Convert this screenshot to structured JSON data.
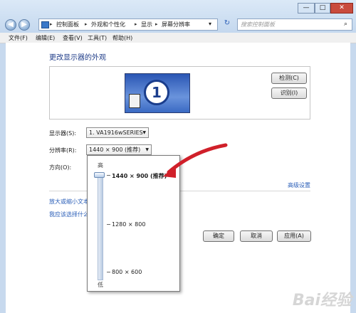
{
  "address_bar": {
    "breadcrumbs": [
      "控制面板",
      "外观和个性化",
      "显示",
      "屏幕分辨率"
    ]
  },
  "search": {
    "placeholder": "搜索控制面板"
  },
  "menu": {
    "items": [
      "文件(F)",
      "编辑(E)",
      "查看(V)",
      "工具(T)",
      "帮助(H)"
    ]
  },
  "page": {
    "title": "更改显示器的外观"
  },
  "preview": {
    "monitor_number": "1",
    "detect_button": "检测(C)",
    "identify_button": "识别(I)"
  },
  "form": {
    "display_label": "显示器(S):",
    "display_value": "1. VA1916wSERIES",
    "resolution_label": "分辨率(R):",
    "resolution_value": "1440 × 900 (推荐)",
    "orientation_label": "方向(O):"
  },
  "links": {
    "advanced": "高级设置",
    "enlarge_text": "放大或缩小文本",
    "which_settings": "我应该选择什么"
  },
  "dropdown": {
    "high_label": "高",
    "low_label": "低",
    "options": [
      {
        "label": "1440 × 900 (推荐)",
        "selected": true
      },
      {
        "label": "1280 × 800",
        "selected": false
      },
      {
        "label": "800 × 600",
        "selected": false
      }
    ]
  },
  "buttons": {
    "ok": "确定",
    "cancel": "取消",
    "apply": "应用(A)"
  },
  "window": {
    "minimize": "—",
    "maximize": "□",
    "close": "✕"
  },
  "colors": {
    "link": "#2b5fb8",
    "title": "#1f3c88",
    "annotation_arrow": "#d0202a",
    "window_chrome": "#c7d9ee"
  }
}
